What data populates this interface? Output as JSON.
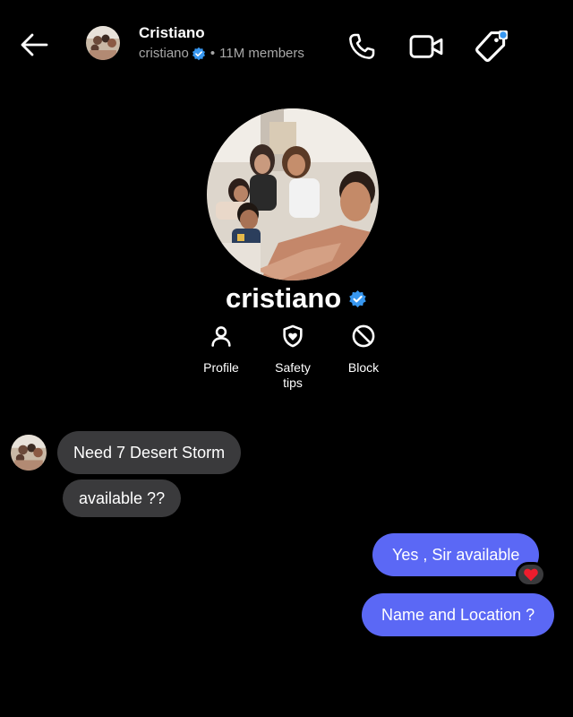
{
  "header": {
    "title": "Cristiano",
    "username": "cristiano",
    "separator": "•",
    "members": "11M members",
    "notification_dot_color": "#3797f0"
  },
  "profile": {
    "name": "cristiano",
    "verified_color": "#3797f0",
    "actions": [
      {
        "label": "Profile",
        "icon": "person-icon"
      },
      {
        "label": "Safety\ntips",
        "icon": "shield-icon"
      },
      {
        "label": "Block",
        "icon": "block-icon"
      }
    ]
  },
  "messages": {
    "incoming": [
      "Need 7 Desert Storm",
      "available ??"
    ],
    "outgoing": [
      "Yes , Sir available",
      "Name and Location ?"
    ],
    "reaction": "❤",
    "incoming_bubble_color": "#3a3a3c",
    "outgoing_bubble_color": "#5b68f5"
  }
}
